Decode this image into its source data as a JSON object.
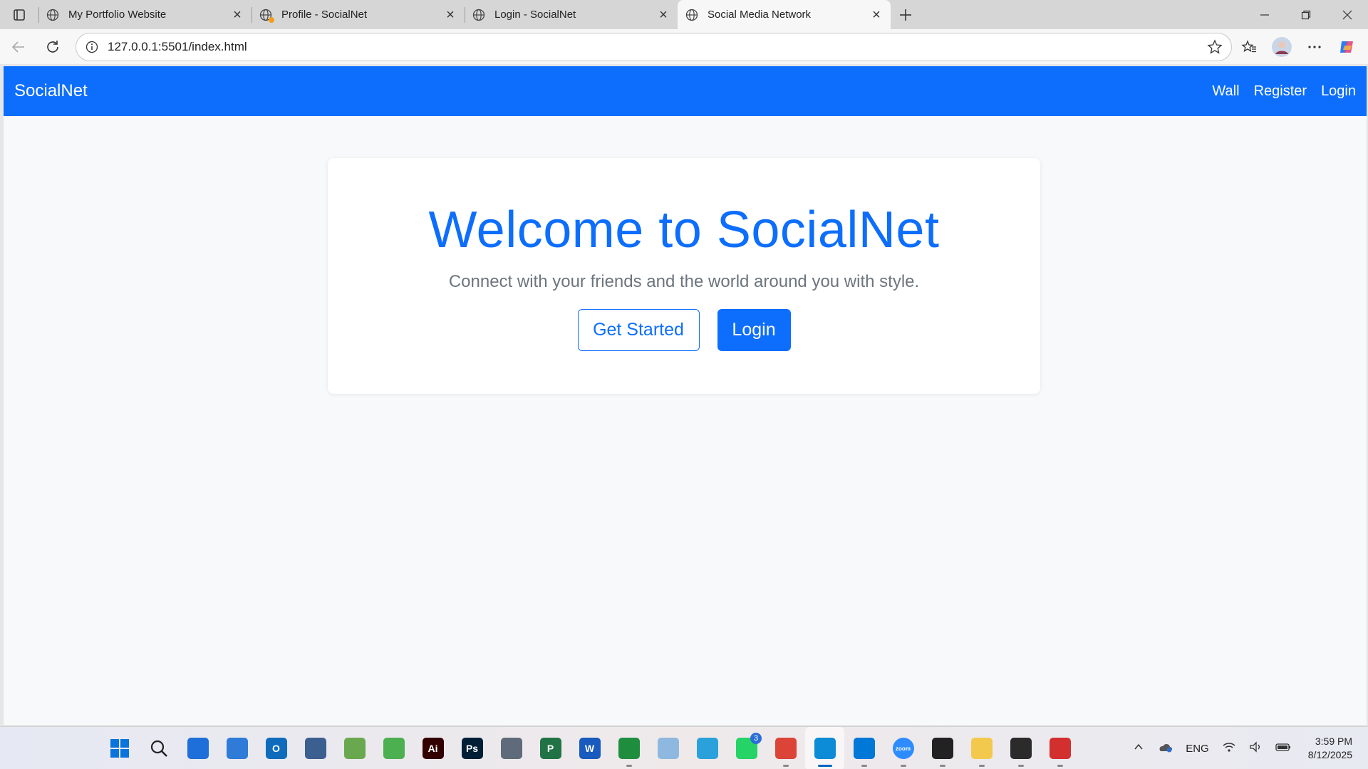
{
  "browser": {
    "tabs": [
      {
        "title": "My Portfolio Website",
        "active": false
      },
      {
        "title": "Profile - SocialNet",
        "active": false
      },
      {
        "title": "Login - SocialNet",
        "active": false
      },
      {
        "title": "Social Media Network",
        "active": true
      }
    ],
    "url": "127.0.0.1:5501/index.html"
  },
  "page": {
    "brand": "SocialNet",
    "nav": {
      "wall": "Wall",
      "register": "Register",
      "login": "Login"
    },
    "hero": {
      "title": "Welcome to SocialNet",
      "subtitle": "Connect with your friends and the world around you with style.",
      "get_started": "Get Started",
      "login": "Login"
    },
    "colors": {
      "primary": "#0d6efd",
      "muted": "#6c757d",
      "background": "#f8f9fa"
    }
  },
  "taskbar": {
    "apps": [
      {
        "name": "start-icon",
        "color": "#0078d4"
      },
      {
        "name": "search-icon",
        "color": "#333333"
      },
      {
        "name": "store-icon",
        "color": "#1e6fd9"
      },
      {
        "name": "calendar-icon",
        "color": "#2f7bd8"
      },
      {
        "name": "outlook-icon",
        "color": "#0f6cbd",
        "label": "O"
      },
      {
        "name": "mysql-workbench-icon",
        "color": "#3b5f8f"
      },
      {
        "name": "image-viewer-icon",
        "color": "#6aa84f"
      },
      {
        "name": "spreadsheet-tool-icon",
        "color": "#4caf50"
      },
      {
        "name": "illustrator-icon",
        "color": "#330000",
        "label": "Ai"
      },
      {
        "name": "photoshop-icon",
        "color": "#001e36",
        "label": "Ps"
      },
      {
        "name": "calculator-icon",
        "color": "#5f6b7a"
      },
      {
        "name": "project-icon",
        "color": "#217346",
        "label": "P"
      },
      {
        "name": "word-icon",
        "color": "#185abd",
        "label": "W"
      },
      {
        "name": "sheets-icon",
        "color": "#1e8e3e"
      },
      {
        "name": "remote-desktop-icon",
        "color": "#8fb8e0"
      },
      {
        "name": "telegram-icon",
        "color": "#2aa1da"
      },
      {
        "name": "whatsapp-icon",
        "color": "#25d366",
        "badge": "3"
      },
      {
        "name": "chrome-icon",
        "color": "#db4437"
      },
      {
        "name": "edge-icon",
        "color": "#0c8bd6",
        "active": true
      },
      {
        "name": "vscode-icon",
        "color": "#0078d7"
      },
      {
        "name": "zoom-icon",
        "color": "#2d8cff",
        "label": "zoom"
      },
      {
        "name": "sticky-notes-icon",
        "color": "#222222"
      },
      {
        "name": "file-explorer-icon",
        "color": "#f2c94c"
      },
      {
        "name": "terminal-icon",
        "color": "#2b2b2b"
      },
      {
        "name": "acrobat-icon",
        "color": "#d32f2f"
      }
    ],
    "tray": {
      "language": "ENG",
      "time": "3:59 PM",
      "date": "8/12/2025"
    }
  }
}
